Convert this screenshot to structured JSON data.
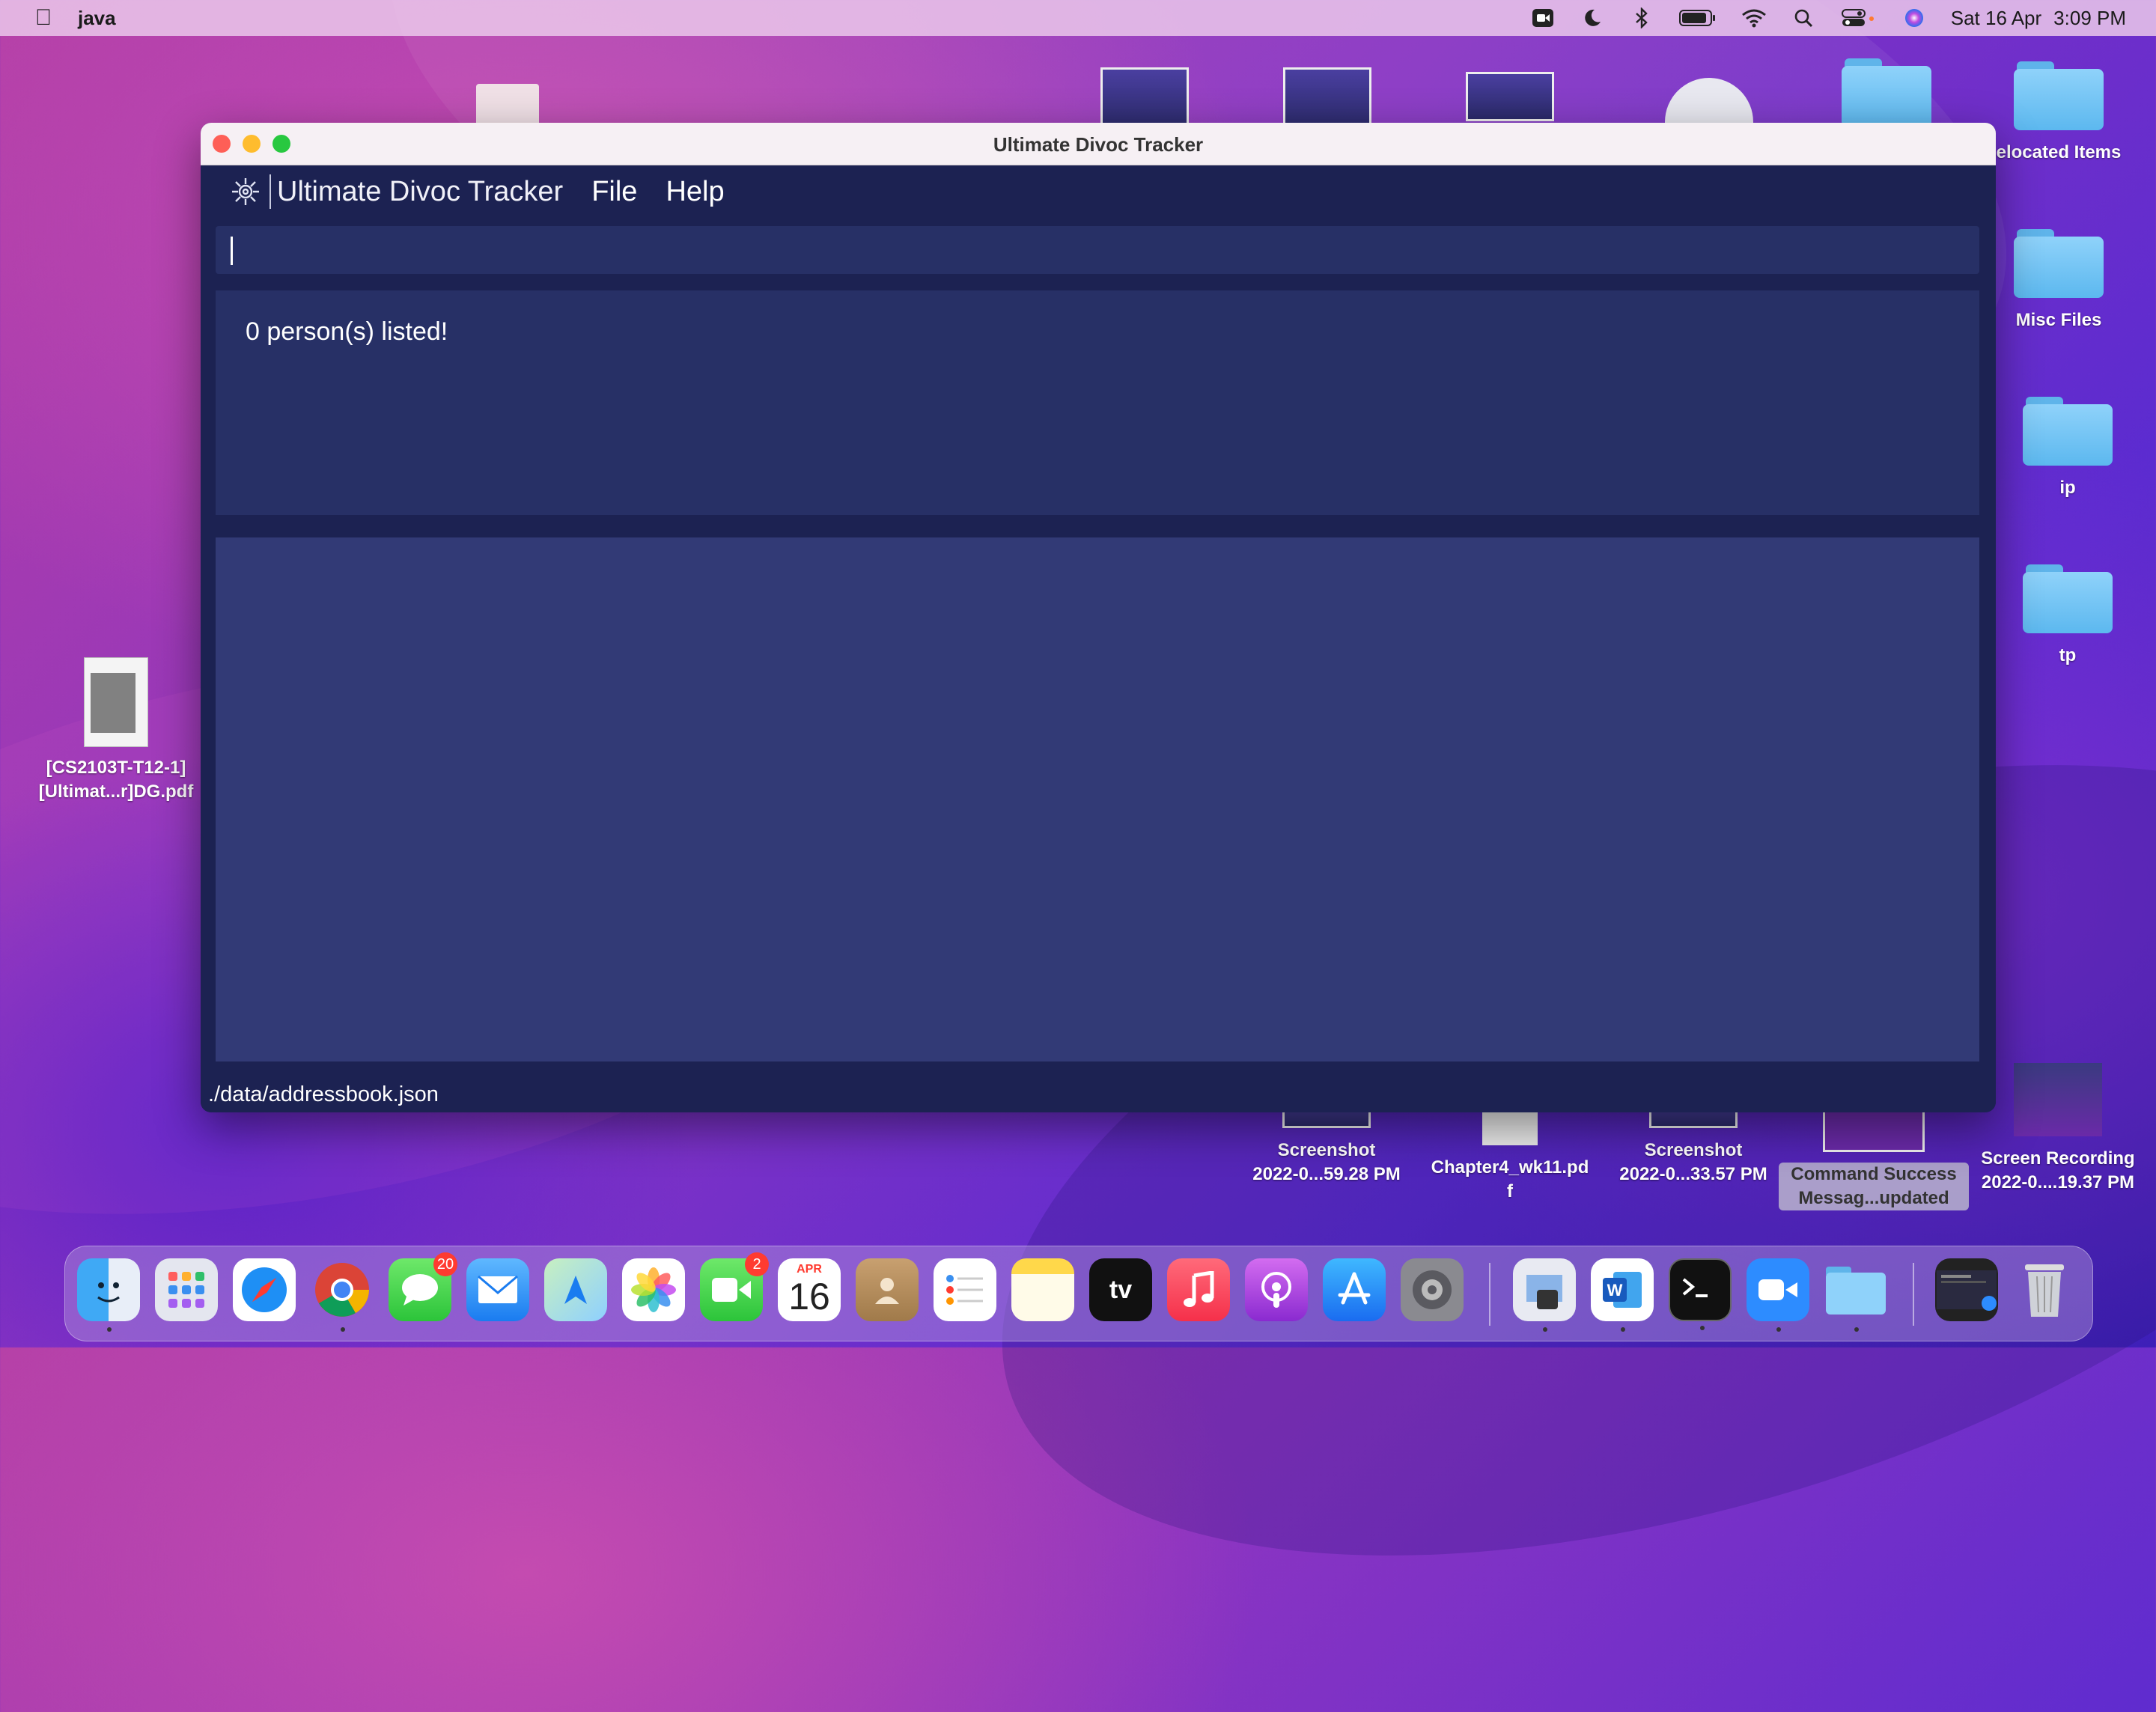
{
  "menubar": {
    "app_name": "java",
    "clock_date": "Sat 16 Apr",
    "clock_time": "3:09 PM",
    "status_icons": [
      "screen-recording-icon",
      "do-not-disturb-icon",
      "bluetooth-icon",
      "battery-icon",
      "wifi-icon",
      "spotlight-icon",
      "control-center-icon",
      "siri-icon"
    ]
  },
  "desktop": {
    "pdf_label_line1": "[CS2103T-T12-1]",
    "pdf_label_line2": "[Ultimat...r]DG.pdf",
    "folders": [
      "elocated Items",
      "Misc Files",
      "ip",
      "tp"
    ],
    "screenshot1_l1": "Screenshot",
    "screenshot1_l2": "2022-0...59.28 PM",
    "chapter_l1": "Chapter4_wk11.pd",
    "chapter_l2": "f",
    "screenshot2_l1": "Screenshot",
    "screenshot2_l2": "2022-0...33.57 PM",
    "command_l1": "Command Success",
    "command_l2": "Messag...updated",
    "recording_l1": "Screen Recording",
    "recording_l2": "2022-0....19.37 PM"
  },
  "window": {
    "title": "Ultimate Divoc Tracker",
    "brand": "Ultimate Divoc Tracker",
    "menu": [
      "File",
      "Help"
    ],
    "command_value": "",
    "result_text": "0 person(s) listed!",
    "status_path": "./data/addressbook.json"
  },
  "dock": {
    "apps": [
      "finder",
      "launchpad",
      "safari",
      "chrome",
      "messages",
      "mail",
      "maps",
      "photos",
      "facetime",
      "calendar",
      "contacts",
      "reminders",
      "notes",
      "apple-tv",
      "music",
      "podcasts",
      "app-store",
      "system-preferences",
      "preview",
      "word",
      "terminal",
      "zoom",
      "folder",
      "screen-recording",
      "trash"
    ],
    "messages_badge": "20",
    "facetime_badge": "2",
    "calendar_month": "APR",
    "calendar_day": "16",
    "tv_label": "tv"
  }
}
